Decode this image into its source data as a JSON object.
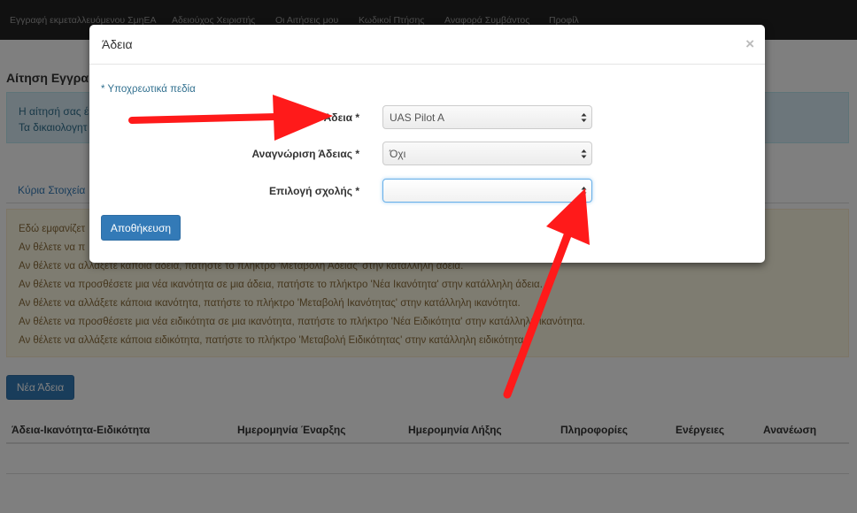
{
  "navbar": {
    "items": [
      "Εγγραφή εκμεταλλευόμενου ΣμηΕΑ",
      "Αδειούχος Χειριστής",
      "Οι Αιτήσεις μου",
      "Κωδικοί Πτήσης",
      "Αναφορά Συμβάντος",
      "Προφίλ"
    ]
  },
  "page": {
    "title": "Αίτηση Εγγρα",
    "info_line1": "Η αίτησή σας έ",
    "info_line2": "Τα δικαιολογητ",
    "tab_main": "Κύρια Στοιχεία",
    "help_lines": [
      "Εδώ εμφανίζετ",
      "Αν θέλετε να π",
      "Αν θέλετε να αλλάξετε κάποια άδεια, πατήστε το πλήκτρο 'Μεταβολή Άδειας' στην κατάλληλη άδεια.",
      "Αν θέλετε να προσθέσετε μια νέα ικανότητα σε μια άδεια, πατήστε το πλήκτρο 'Νέα Ικανότητα' στην κατάλληλη άδεια.",
      "Αν θέλετε να αλλάξετε κάποια ικανότητα, πατήστε το πλήκτρο 'Μεταβολή Ικανότητας' στην κατάλληλη ικανότητα.",
      "Αν θέλετε να προσθέσετε μια νέα ειδικότητα σε μια ικανότητα, πατήστε το πλήκτρο 'Νέα Ειδικότητα' στην κατάλληλη ικανότητα.",
      "Αν θέλετε να αλλάξετε κάποια ειδικότητα, πατήστε το πλήκτρο 'Μεταβολή Ειδικότητας' στην κατάλληλη ειδικότητα."
    ],
    "new_license_button": "Νέα Άδεια",
    "table_headers": [
      "Άδεια-Ικανότητα-Ειδικότητα",
      "Ημερομηνία Έναρξης",
      "Ημερομηνία Λήξης",
      "Πληροφορίες",
      "Ενέργειες",
      "Ανανέωση"
    ]
  },
  "modal": {
    "title": "Άδεια",
    "close": "×",
    "required_note": "* Υποχρεωτικά πεδία",
    "fields": [
      {
        "label": "Άδεια *",
        "value": "UAS Pilot A"
      },
      {
        "label": "Αναγνώριση Άδειας *",
        "value": "Όχι"
      },
      {
        "label": "Επιλογή σχολής *",
        "value": ""
      }
    ],
    "save_button": "Αποθήκευση"
  },
  "colors": {
    "primary": "#337ab7",
    "annotation_arrow": "#ff1a1a",
    "navbar": "#222222"
  },
  "icons": {
    "select_caret": "updown-caret-icon",
    "close": "close-icon"
  }
}
